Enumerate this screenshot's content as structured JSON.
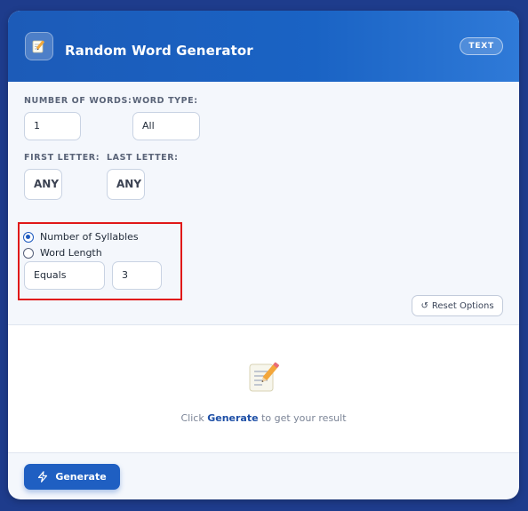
{
  "header": {
    "title": "Random Word Generator",
    "badge": "TEXT",
    "icon": "notepad-pencil-icon"
  },
  "fields": {
    "number_of_words": {
      "label": "NUMBER OF WORDS:",
      "value": "1"
    },
    "word_type": {
      "label": "WORD TYPE:",
      "value": "All"
    },
    "first_letter": {
      "label": "FIRST LETTER:",
      "value": "ANY"
    },
    "last_letter": {
      "label": "LAST LETTER:",
      "value": "ANY"
    }
  },
  "length_mode": {
    "options": [
      "Number of Syllables",
      "Word Length"
    ],
    "selected": "Number of Syllables",
    "comparator": "Equals",
    "value": "3"
  },
  "reset": {
    "label": "Reset Options",
    "icon": "reset-arrow-icon"
  },
  "result": {
    "prefix": "Click",
    "action": "Generate",
    "suffix": "to get your result",
    "icon": "notepad-pencil-icon"
  },
  "generate": {
    "label": "Generate",
    "icon": "lightning-icon"
  },
  "colors": {
    "background": "#1e3c8c",
    "header": "#1a63c4",
    "accent": "#1f5fc2",
    "highlight": "#e01818"
  }
}
